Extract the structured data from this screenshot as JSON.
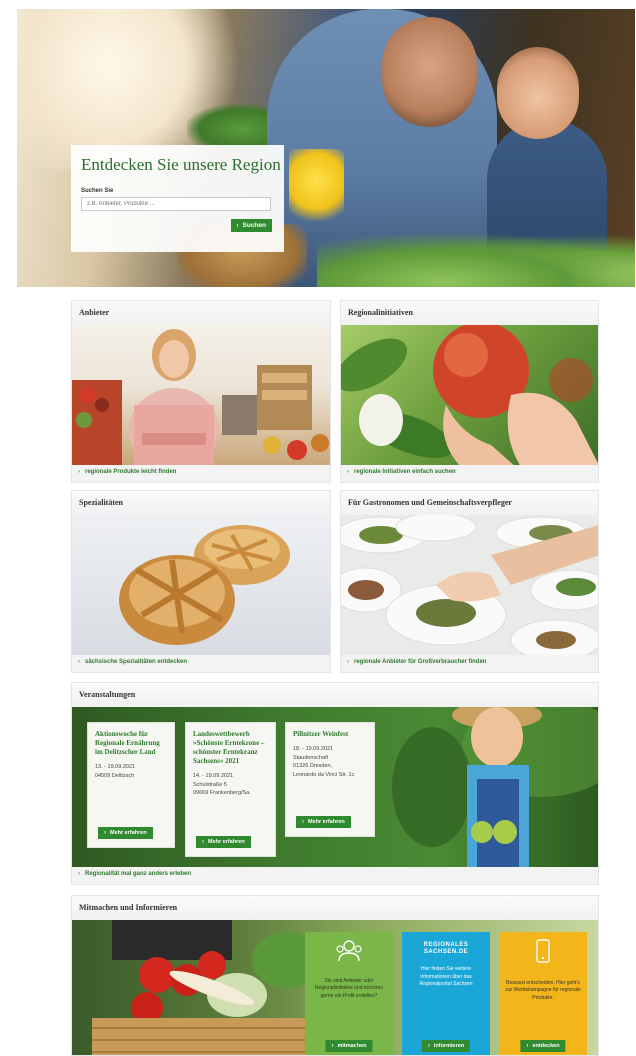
{
  "hero": {
    "title": "Entdecken Sie unsere Region",
    "search_label": "Suchen Sie",
    "search_placeholder": "z.B. Anbieter, Produkte ...",
    "search_button": "Suchen"
  },
  "cards": [
    {
      "title": "Anbieter",
      "link": "regionale Produkte leicht finden"
    },
    {
      "title": "Regionalinitiativen",
      "link": "regionale Initiativen einfach suchen"
    },
    {
      "title": "Spezialitäten",
      "link": "sächsische Spezialitäten entdecken"
    },
    {
      "title": "Für Gastronomen und Gemeinschaftsverpfleger",
      "link": "regionale Anbieter für Großverbraucher finden"
    }
  ],
  "events": {
    "title": "Veranstaltungen",
    "items": [
      {
        "title": "Aktionswoche für Regionale Ernährung im Delitzscher Land",
        "date": "13. - 19.09.2021",
        "addr1": "04509 Delitzsch",
        "addr2": "",
        "button": "Mehr erfahren"
      },
      {
        "title": "Landeswettbewerb »Schönste Erntekrone – schönster Erntekranz Sachsens« 2021",
        "date": "14. - 19.09.2021",
        "addr1": "Schulstraße 5",
        "addr2": "09669 Frankenberg/Sa.",
        "button": "Mehr erfahren"
      },
      {
        "title": "Pillnitzer Weinfest",
        "date": "18. - 19.09.2021",
        "addr1": "Staudenschaft",
        "addr2": "01326 Dresden,",
        "addr3": "Leonardo da Vinci Str. 1c",
        "button": "Mehr erfahren"
      }
    ],
    "link": "Regionalität mal ganz anders erleben"
  },
  "mitmachen": {
    "title": "Mitmachen und Informieren",
    "tiles": [
      {
        "icon": "people-icon",
        "text": "Sie sind Anbieter oder Regionalinitiative und möchten gerne ein Profil erstellen?",
        "button": "mitmachen",
        "color": "#7ab648"
      },
      {
        "icon": "regionales-sachsen-logo",
        "logo_text": "REGIONALES SACHSEN.DE",
        "text": "Hier finden Sie weitere Informationen über das Regionalportal Sachsen",
        "button": "informieren",
        "color": "#1aa6d6"
      },
      {
        "icon": "phone-icon",
        "text": "Bewusst entscheiden. Hier geht's zur Werbekampagne für regionale Produkte.",
        "button": "entdecken",
        "color": "#f2b51a"
      }
    ]
  },
  "colors": {
    "accent": "#2f8a30",
    "link": "#2f7a2f"
  }
}
